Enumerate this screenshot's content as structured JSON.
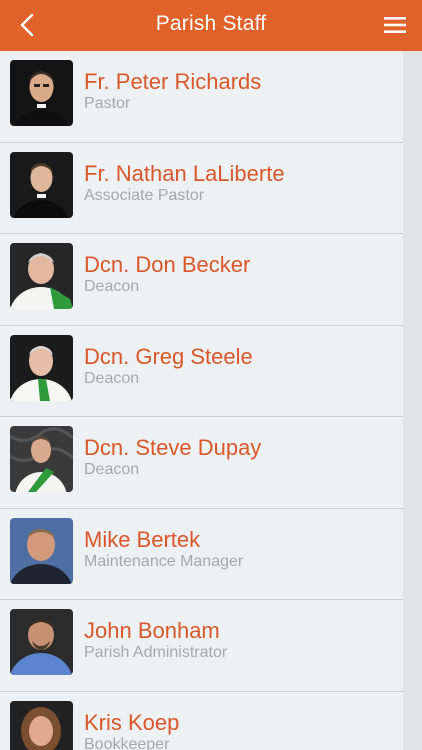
{
  "header": {
    "title": "Parish Staff",
    "back_icon": "chevron-left-icon",
    "menu_icon": "hamburger-menu-icon"
  },
  "colors": {
    "accent": "#e0612a",
    "name_text": "#d9572a",
    "role_text": "#a4a9ad",
    "background": "#eef1f3"
  },
  "staff": [
    {
      "name": "Fr. Peter Richards",
      "role": "Pastor"
    },
    {
      "name": "Fr. Nathan LaLiberte",
      "role": "Associate Pastor"
    },
    {
      "name": "Dcn. Don Becker",
      "role": "Deacon"
    },
    {
      "name": "Dcn. Greg Steele",
      "role": "Deacon"
    },
    {
      "name": "Dcn. Steve Dupay",
      "role": "Deacon"
    },
    {
      "name": "Mike Bertek",
      "role": "Maintenance Manager"
    },
    {
      "name": "John Bonham",
      "role": "Parish Administrator"
    },
    {
      "name": "Kris Koep",
      "role": "Bookkeeper"
    }
  ]
}
